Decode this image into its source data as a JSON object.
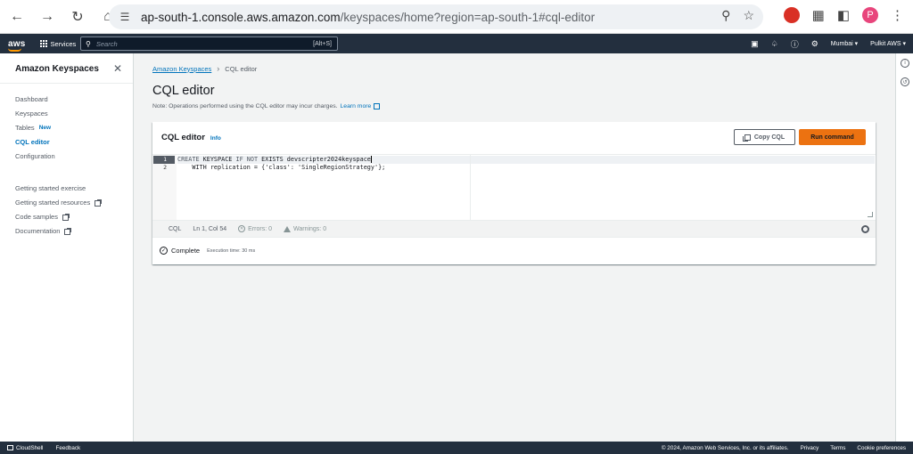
{
  "browser": {
    "url_host": "ap-south-1.console.aws.amazon.com",
    "url_path": "/keyspaces/home?region=ap-south-1#cql-editor",
    "profile_initial": "P"
  },
  "aws_topbar": {
    "logo": "aws",
    "services_label": "Services",
    "search_placeholder": "Search",
    "search_shortcut": "[Alt+S]",
    "region_label": "Mumbai",
    "account_label": "Pulkit AWS"
  },
  "sidebar": {
    "title": "Amazon Keyspaces",
    "items": [
      {
        "label": "Dashboard"
      },
      {
        "label": "Keyspaces"
      },
      {
        "label": "Tables",
        "badge": "New"
      },
      {
        "label": "CQL editor"
      },
      {
        "label": "Configuration"
      }
    ],
    "secondary_items": [
      {
        "label": "Getting started exercise"
      },
      {
        "label": "Getting started resources"
      },
      {
        "label": "Code samples"
      },
      {
        "label": "Documentation"
      }
    ]
  },
  "breadcrumb": {
    "parent": "Amazon Keyspaces",
    "current": "CQL editor"
  },
  "page": {
    "title": "CQL editor",
    "note": "Note: Operations performed using the CQL editor may incur charges.",
    "learn_more": "Learn more"
  },
  "editor_card": {
    "title": "CQL editor",
    "info": "Info",
    "copy_button": "Copy CQL",
    "run_button": "Run command",
    "lines": [
      {
        "number": "1",
        "kw1": "CREATE",
        "t1": " KEYSPACE ",
        "kw2": "IF NOT",
        "t2": " EXISTS devscripter2024keyspace"
      },
      {
        "number": "2",
        "text": "    WITH replication = {'class': 'SingleRegionStrategy'};"
      }
    ],
    "status": {
      "language": "CQL",
      "position": "Ln 1, Col 54",
      "errors": "Errors: 0",
      "warnings": "Warnings: 0"
    },
    "result": {
      "state": "Complete",
      "execution_time": "Execution time: 30 ms"
    }
  },
  "footer": {
    "cloudshell": "CloudShell",
    "feedback": "Feedback",
    "copyright": "© 2024, Amazon Web Services, Inc. or its affiliates.",
    "privacy": "Privacy",
    "terms": "Terms",
    "cookies": "Cookie preferences"
  },
  "colors": {
    "aws_navy": "#232f3e",
    "accent_orange": "#ec7211",
    "link_blue": "#0073bb"
  }
}
